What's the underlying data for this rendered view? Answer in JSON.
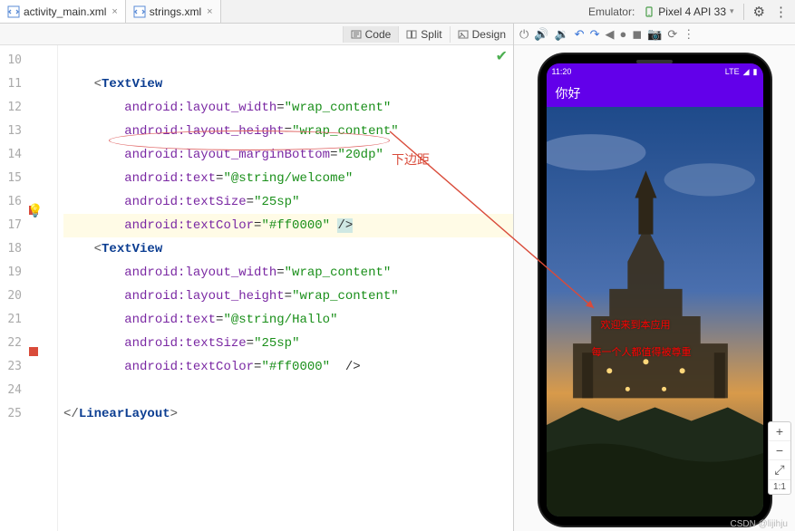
{
  "tabs": [
    {
      "label": "activity_main.xml",
      "active": true
    },
    {
      "label": "strings.xml",
      "active": false
    }
  ],
  "emulator": {
    "label": "Emulator:",
    "device": "Pixel 4 API 33"
  },
  "designModes": {
    "code": "Code",
    "split": "Split",
    "design": "Design"
  },
  "gutter": {
    "start": 10,
    "end": 25
  },
  "code": {
    "l11": {
      "tag": "TextView"
    },
    "l12": {
      "attr": "android:layout_width",
      "val": "wrap_content"
    },
    "l13": {
      "attr": "android:layout_height",
      "val": "wrap_content"
    },
    "l14": {
      "attr": "android:layout_marginBottom",
      "val": "20dp"
    },
    "l15": {
      "attr": "android:text",
      "val": "@string/welcome"
    },
    "l16": {
      "attr": "android:textSize",
      "val": "25sp"
    },
    "l17": {
      "attr": "android:textColor",
      "val": "#ff0000"
    },
    "l18": {
      "tag": "TextView"
    },
    "l19": {
      "attr": "android:layout_width",
      "val": "wrap_content"
    },
    "l20": {
      "attr": "android:layout_height",
      "val": "wrap_content"
    },
    "l21": {
      "attr": "android:text",
      "val": "@string/Hallo"
    },
    "l22": {
      "attr": "android:textSize",
      "val": "25sp"
    },
    "l23": {
      "attr": "android:textColor",
      "val": "#ff0000"
    },
    "l25": {
      "tag": "LinearLayout"
    }
  },
  "annotation": {
    "label": "下边距"
  },
  "phone": {
    "time": "11:20",
    "net": "LTE",
    "title": "你好",
    "line1": "欢迎来到本应用",
    "line2": "每一个人都值得被尊重"
  },
  "zoom": {
    "plus": "+",
    "minus": "−",
    "fit": "⤢",
    "ratio": "1:1"
  },
  "watermark": "CSDN @lijihju"
}
